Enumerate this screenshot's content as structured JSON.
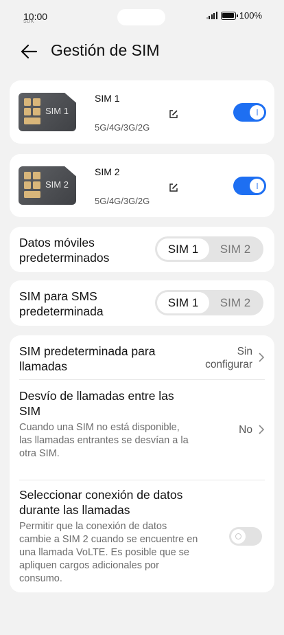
{
  "status_bar": {
    "time": "10:00",
    "carrier": "SDK",
    "battery": "100%",
    "signal_icon": "signal-bars-icon",
    "battery_icon": "battery-full-icon"
  },
  "header": {
    "title": "Gestión de SIM",
    "back_icon": "arrow-left-icon"
  },
  "sims": [
    {
      "chip_label": "SIM 1",
      "name": "SIM 1",
      "network": "5G/4G/3G/2G",
      "enabled": true
    },
    {
      "chip_label": "SIM 2",
      "name": "SIM 2",
      "network": "5G/4G/3G/2G",
      "enabled": true
    }
  ],
  "mobile_data": {
    "title": "Datos móviles predeterminados",
    "options": [
      "SIM 1",
      "SIM 2"
    ],
    "selected": "SIM 1"
  },
  "sms": {
    "title": "SIM para SMS predeterminada",
    "options": [
      "SIM 1",
      "SIM 2"
    ],
    "selected": "SIM 1"
  },
  "calls_default": {
    "title": "SIM predeterminada para llamadas",
    "value_line1": "Sin",
    "value_line2": "configurar"
  },
  "call_forwarding": {
    "title": "Desvío de llamadas entre las SIM",
    "description": "Cuando una SIM no está disponible, las llamadas entrantes se desvían a la otra SIM.",
    "value": "No"
  },
  "data_during_calls": {
    "title": "Seleccionar conexión de datos durante las llamadas",
    "description": "Permitir que la conexión de datos cambie a SIM 2 cuando se encuentre en una llamada VoLTE. Es posible que se apliquen cargos adicionales por consumo.",
    "enabled": false
  },
  "colors": {
    "accent": "#1e6ff2",
    "background": "#f2f2f2",
    "card": "#ffffff"
  }
}
